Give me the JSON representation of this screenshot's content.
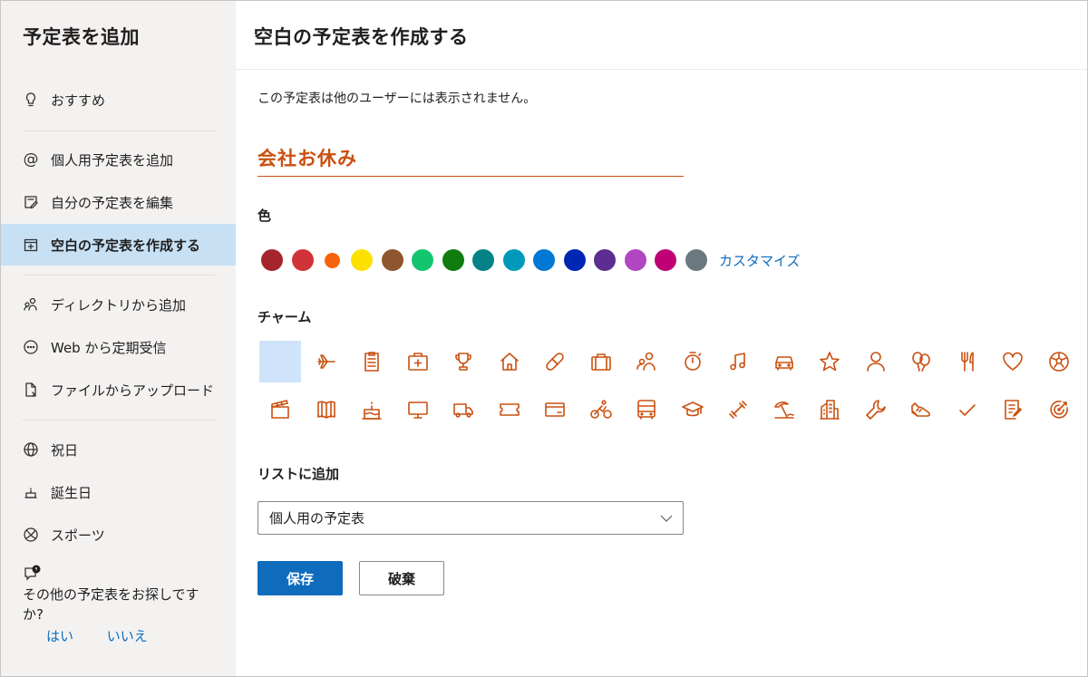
{
  "sidebar": {
    "title": "予定表を追加",
    "items": [
      {
        "label": "おすすめ",
        "icon": "lightbulb-icon"
      },
      {
        "label": "個人用予定表を追加",
        "icon": "at-icon"
      },
      {
        "label": "自分の予定表を編集",
        "icon": "edit-calendar-icon"
      },
      {
        "label": "空白の予定表を作成する",
        "icon": "calendar-add-icon",
        "active": true
      },
      {
        "label": "ディレクトリから追加",
        "icon": "people-icon"
      },
      {
        "label": "Web から定期受信",
        "icon": "web-icon"
      },
      {
        "label": "ファイルからアップロード",
        "icon": "file-upload-icon"
      },
      {
        "label": "祝日",
        "icon": "globe-icon"
      },
      {
        "label": "誕生日",
        "icon": "cake-icon"
      },
      {
        "label": "スポーツ",
        "icon": "sports-icon"
      }
    ],
    "feedback": {
      "question": "その他の予定表をお探しですか?",
      "yes": "はい",
      "no": "いいえ"
    }
  },
  "main": {
    "title": "空白の予定表を作成する",
    "notice": "この予定表は他のユーザーには表示されません。",
    "calendar_name": "会社お休み",
    "color_label": "色",
    "colors": [
      "#a4262c",
      "#d13438",
      "#f7630c",
      "#fce100",
      "#8e562e",
      "#13c66e",
      "#107c10",
      "#038387",
      "#0099bc",
      "#0078d4",
      "#0027b4",
      "#5c2e91",
      "#b146c2",
      "#bf0077",
      "#69797e"
    ],
    "customize_label": "カスタマイズ",
    "charm_label": "チャーム",
    "accent_color": "#ca5010",
    "list_label": "リストに追加",
    "list_value": "個人用の予定表",
    "save_label": "保存",
    "discard_label": "破棄",
    "charms": [
      "none",
      "airplane",
      "clipboard",
      "first-aid",
      "trophy",
      "home",
      "pill",
      "briefcase",
      "people",
      "timer",
      "music",
      "car",
      "star",
      "person",
      "balloons",
      "utensils",
      "heart",
      "soccer",
      "clapperboard",
      "book",
      "cake",
      "monitor",
      "truck",
      "ticket",
      "credit-card",
      "cyclist",
      "bus",
      "graduation-cap",
      "dumbbell",
      "beach",
      "building",
      "wrench",
      "sneaker",
      "checkmark",
      "notepad",
      "target"
    ]
  }
}
